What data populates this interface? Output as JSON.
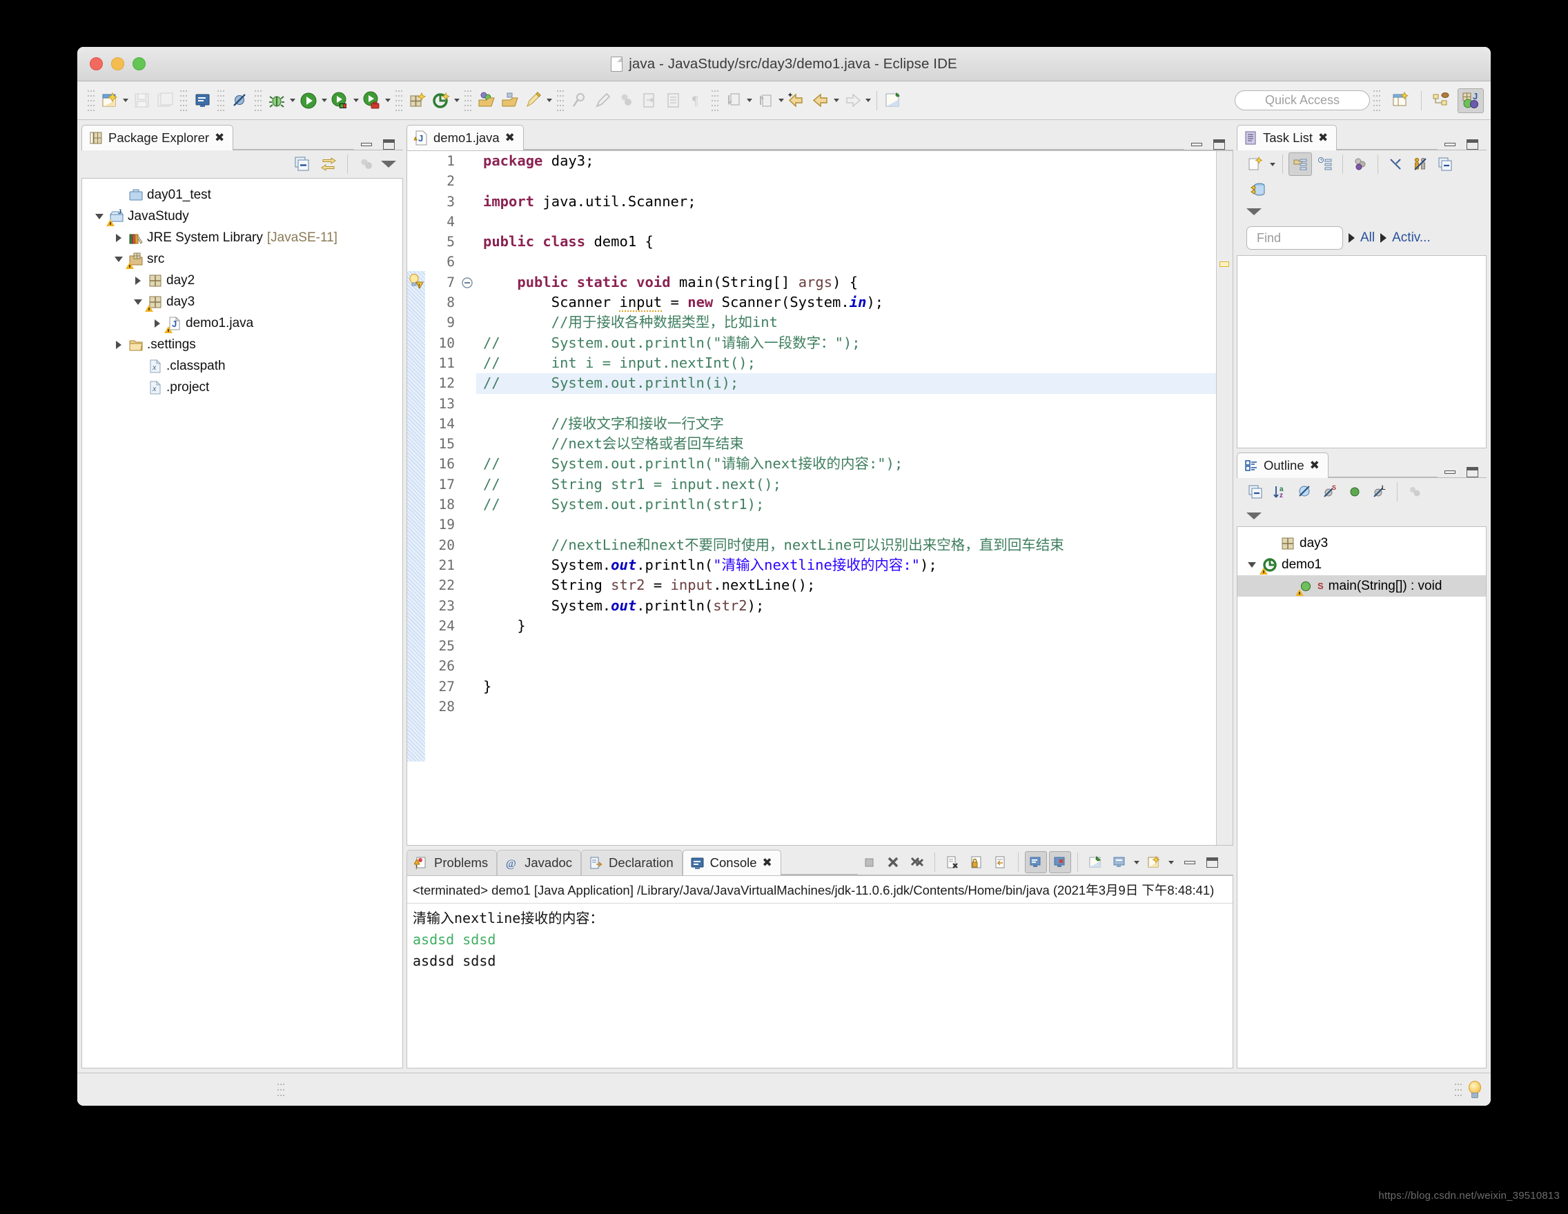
{
  "window": {
    "title": "java - JavaStudy/src/day3/demo1.java - Eclipse IDE",
    "traffic": {
      "close": "close-button",
      "minimize": "minimize-button",
      "zoom": "zoom-button"
    }
  },
  "toolbar": {
    "quick_access_placeholder": "Quick Access",
    "items": [
      "new-wizard",
      "save",
      "save-all",
      "console-view",
      "skip-breakpoints",
      "debug",
      "run",
      "run-coverage",
      "external-tools",
      "new-java-package",
      "new-java-class",
      "open-type",
      "open-task",
      "toggle-mark-occurrences",
      "annotation",
      "search",
      "next-annotation",
      "previous-annotation",
      "paragraph",
      "back",
      "forward",
      "pin-editor"
    ]
  },
  "package_explorer": {
    "tab_label": "Package Explorer",
    "toolbar_items": [
      "collapse-all",
      "link-with-editor",
      "view-menu",
      "filters"
    ],
    "tree": [
      {
        "label": "day01_test",
        "indent": 1,
        "icon": "project-closed-icon",
        "twisty": "none",
        "warning": false
      },
      {
        "label": "JavaStudy",
        "indent": 0,
        "icon": "java-project-icon",
        "twisty": "open",
        "warning": true
      },
      {
        "label": "JRE System Library",
        "suffix": " [JavaSE-11]",
        "indent": 1,
        "icon": "jre-library-icon",
        "twisty": "closed",
        "warning": false
      },
      {
        "label": "src",
        "indent": 1,
        "icon": "source-folder-icon",
        "twisty": "open",
        "warning": true
      },
      {
        "label": "day2",
        "indent": 2,
        "icon": "package-icon",
        "twisty": "closed",
        "warning": false
      },
      {
        "label": "day3",
        "indent": 2,
        "icon": "package-icon",
        "twisty": "open",
        "warning": true
      },
      {
        "label": "demo1.java",
        "indent": 3,
        "icon": "java-file-icon",
        "twisty": "closed",
        "warning": true
      },
      {
        "label": ".settings",
        "indent": 1,
        "icon": "folder-icon",
        "twisty": "closed",
        "warning": false
      },
      {
        "label": ".classpath",
        "indent": 2,
        "icon": "xml-file-icon",
        "twisty": "none",
        "warning": false
      },
      {
        "label": ".project",
        "indent": 2,
        "icon": "xml-file-icon",
        "twisty": "none",
        "warning": false
      }
    ]
  },
  "editor": {
    "tab_label": "demo1.java",
    "current_line": 12,
    "lines": [
      {
        "n": 1,
        "tokens": [
          {
            "t": "package",
            "c": "kw"
          },
          {
            "t": " day3;",
            "c": ""
          }
        ]
      },
      {
        "n": 2,
        "tokens": []
      },
      {
        "n": 3,
        "tokens": [
          {
            "t": "import",
            "c": "kw"
          },
          {
            "t": " java.util.Scanner;",
            "c": ""
          }
        ]
      },
      {
        "n": 4,
        "tokens": []
      },
      {
        "n": 5,
        "tokens": [
          {
            "t": "public class",
            "c": "kw"
          },
          {
            "t": " demo1 {",
            "c": ""
          }
        ]
      },
      {
        "n": 6,
        "tokens": []
      },
      {
        "n": 7,
        "fold": true,
        "tokens": [
          {
            "t": "    ",
            "c": ""
          },
          {
            "t": "public static void",
            "c": "kw"
          },
          {
            "t": " main(String[] ",
            "c": ""
          },
          {
            "t": "args",
            "c": "prm"
          },
          {
            "t": ") {",
            "c": ""
          }
        ]
      },
      {
        "n": 8,
        "marker": "warning-bulb",
        "tokens": [
          {
            "t": "        Scanner ",
            "c": ""
          },
          {
            "t": "input",
            "c": "undl"
          },
          {
            "t": " = ",
            "c": ""
          },
          {
            "t": "new",
            "c": "kw"
          },
          {
            "t": " Scanner(System.",
            "c": ""
          },
          {
            "t": "in",
            "c": "fld"
          },
          {
            "t": ");",
            "c": ""
          }
        ]
      },
      {
        "n": 9,
        "tokens": [
          {
            "t": "        //用于接收各种数据类型，比如int",
            "c": "cm"
          }
        ]
      },
      {
        "n": 10,
        "tokens": [
          {
            "t": "//      System.out.println(\"请输入一段数字：\");",
            "c": "cm"
          }
        ]
      },
      {
        "n": 11,
        "tokens": [
          {
            "t": "//      int i = input.nextInt();",
            "c": "cm"
          }
        ]
      },
      {
        "n": 12,
        "tokens": [
          {
            "t": "//      System.out.println(i);",
            "c": "cm"
          }
        ]
      },
      {
        "n": 13,
        "tokens": []
      },
      {
        "n": 14,
        "tokens": [
          {
            "t": "        //接收文字和接收一行文字",
            "c": "cm"
          }
        ]
      },
      {
        "n": 15,
        "tokens": [
          {
            "t": "        //next会以空格或者回车结束",
            "c": "cm"
          }
        ]
      },
      {
        "n": 16,
        "tokens": [
          {
            "t": "//      System.out.println(\"请输入next接收的内容:\");",
            "c": "cm"
          }
        ]
      },
      {
        "n": 17,
        "tokens": [
          {
            "t": "//      String str1 = input.next();",
            "c": "cm"
          }
        ]
      },
      {
        "n": 18,
        "tokens": [
          {
            "t": "//      System.out.println(str1);",
            "c": "cm"
          }
        ]
      },
      {
        "n": 19,
        "tokens": []
      },
      {
        "n": 20,
        "tokens": [
          {
            "t": "        //nextLine和next不要同时使用，nextLine可以识别出来空格，直到回车结束",
            "c": "cm"
          }
        ]
      },
      {
        "n": 21,
        "tokens": [
          {
            "t": "        System.",
            "c": ""
          },
          {
            "t": "out",
            "c": "fld"
          },
          {
            "t": ".println(",
            "c": ""
          },
          {
            "t": "\"清输入nextline接收的内容:\"",
            "c": "str"
          },
          {
            "t": ");",
            "c": ""
          }
        ]
      },
      {
        "n": 22,
        "tokens": [
          {
            "t": "        String ",
            "c": ""
          },
          {
            "t": "str2",
            "c": "loc"
          },
          {
            "t": " = ",
            "c": ""
          },
          {
            "t": "input",
            "c": "loc"
          },
          {
            "t": ".nextLine();",
            "c": ""
          }
        ]
      },
      {
        "n": 23,
        "tokens": [
          {
            "t": "        System.",
            "c": ""
          },
          {
            "t": "out",
            "c": "fld"
          },
          {
            "t": ".println(",
            "c": ""
          },
          {
            "t": "str2",
            "c": "loc"
          },
          {
            "t": ");",
            "c": ""
          }
        ]
      },
      {
        "n": 24,
        "tokens": [
          {
            "t": "    }",
            "c": ""
          }
        ]
      },
      {
        "n": 25,
        "tokens": []
      },
      {
        "n": 26,
        "tokens": []
      },
      {
        "n": 27,
        "tokens": [
          {
            "t": "}",
            "c": ""
          }
        ]
      },
      {
        "n": 28,
        "tokens": []
      }
    ]
  },
  "bottom_panel": {
    "tabs": [
      {
        "label": "Problems",
        "icon": "problems-icon",
        "active": false
      },
      {
        "label": "Javadoc",
        "icon": "javadoc-icon",
        "active": false
      },
      {
        "label": "Declaration",
        "icon": "declaration-icon",
        "active": false
      },
      {
        "label": "Console",
        "icon": "console-icon",
        "active": true
      }
    ],
    "toolbar_items": [
      "terminate",
      "remove-launch",
      "remove-all-terminated",
      "clear-console",
      "scroll-lock",
      "word-wrap",
      "show-console-on-output",
      "show-console-on-error",
      "pin-console",
      "display-selected-console",
      "open-console",
      "minimize",
      "maximize"
    ],
    "console": {
      "header": "<terminated> demo1 [Java Application] /Library/Java/JavaVirtualMachines/jdk-11.0.6.jdk/Contents/Home/bin/java (2021年3月9日 下午8:48:41)",
      "output": [
        {
          "text": "清输入nextline接收的内容：",
          "color": "#111111"
        },
        {
          "text": "asdsd sdsd",
          "color": "#3fae62"
        },
        {
          "text": "asdsd sdsd",
          "color": "#111111"
        }
      ]
    }
  },
  "task_list": {
    "tab_label": "Task List",
    "toolbar_items": [
      "new-task",
      "categorized-presentation",
      "scheduled-presentation",
      "focus-on-workweek",
      "filter-completed-tasks",
      "synchronize-changed",
      "collapse-all",
      "repository-synchronize"
    ],
    "find_placeholder": "Find",
    "filter_all": "All",
    "filter_activate": "Activ..."
  },
  "outline": {
    "tab_label": "Outline",
    "toolbar_items": [
      "collapse-all",
      "sort-alphabetically",
      "hide-fields",
      "hide-static-members",
      "hide-non-public-members",
      "hide-local-types",
      "link-with-editor"
    ],
    "items": [
      {
        "label": "day3",
        "indent": 1,
        "icon": "package-icon",
        "twisty": "none",
        "selected": false,
        "warning": false
      },
      {
        "label": "demo1",
        "indent": 0,
        "icon": "class-icon",
        "twisty": "open",
        "selected": false,
        "warning": true
      },
      {
        "label": "main(String[]) : void",
        "indent": 2,
        "icon": "method-icon",
        "twisty": "none",
        "selected": true,
        "warning": true,
        "badge": "S"
      }
    ]
  },
  "status_bar": {
    "hint_icon": "lightbulb-icon"
  },
  "watermark": "https://blog.csdn.net/weixin_39510813"
}
